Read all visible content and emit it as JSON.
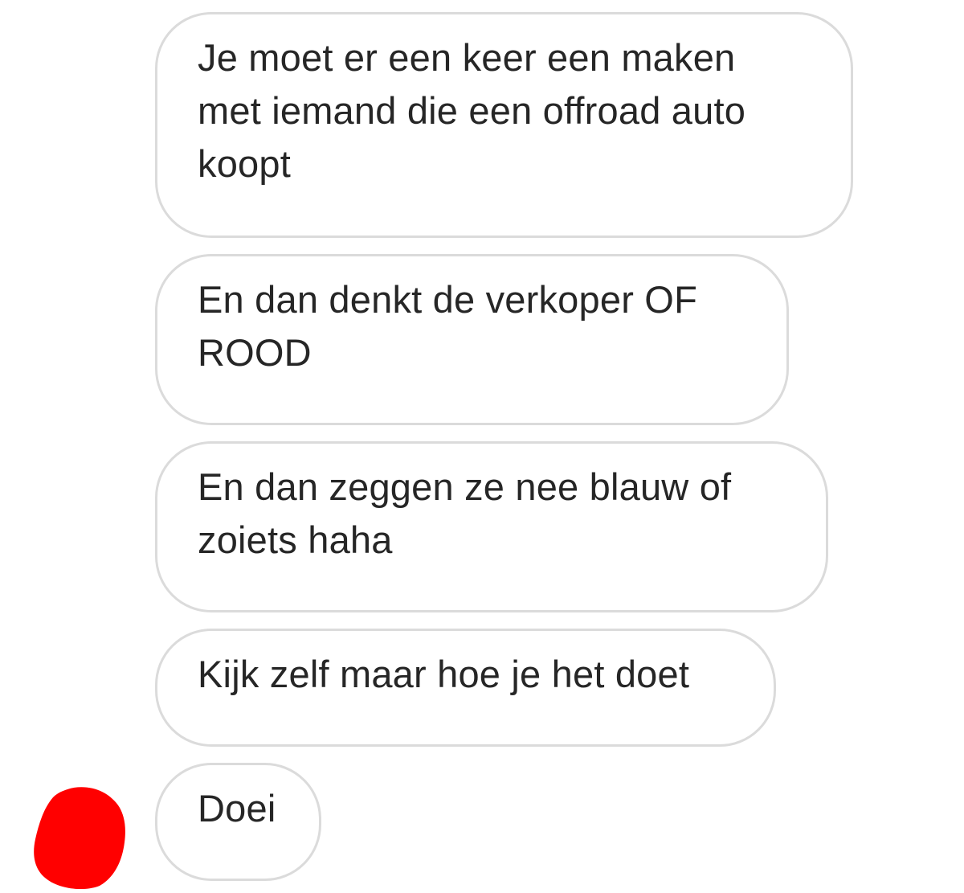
{
  "conversation": {
    "messages": [
      {
        "text": "Je moet er een keer een maken\nmet iemand die een offroad auto\nkoopt"
      },
      {
        "text": "En dan denkt de verkoper OF\nROOD"
      },
      {
        "text": "En dan zeggen ze nee blauw of\nzoiets haha"
      },
      {
        "text": "Kijk zelf maar hoe je het doet"
      },
      {
        "text": "Doei"
      }
    ]
  },
  "colors": {
    "bubble_border": "#dbdbdb",
    "text": "#262626",
    "redaction": "#ff0000"
  },
  "icons": {
    "avatar": "redacted-avatar-icon"
  }
}
